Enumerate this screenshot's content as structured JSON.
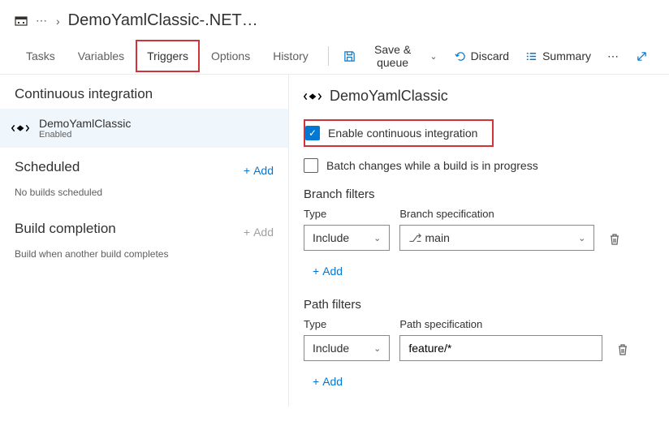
{
  "breadcrumb": {
    "title": "DemoYamlClassic-.NET…"
  },
  "tabs": {
    "tasks": "Tasks",
    "variables": "Variables",
    "triggers": "Triggers",
    "options": "Options",
    "history": "History"
  },
  "toolbar": {
    "save": "Save & queue",
    "discard": "Discard",
    "summary": "Summary"
  },
  "sidebar": {
    "ci_title": "Continuous integration",
    "repo": {
      "name": "DemoYamlClassic",
      "status": "Enabled"
    },
    "scheduled": {
      "title": "Scheduled",
      "add": "Add",
      "empty": "No builds scheduled"
    },
    "completion": {
      "title": "Build completion",
      "add": "Add",
      "empty": "Build when another build completes"
    }
  },
  "main": {
    "title": "DemoYamlClassic",
    "enable_ci": "Enable continuous integration",
    "batch": "Batch changes while a build is in progress",
    "branch_filters": {
      "title": "Branch filters",
      "type_label": "Type",
      "spec_label": "Branch specification",
      "type_value": "Include",
      "spec_value": "main",
      "add": "Add"
    },
    "path_filters": {
      "title": "Path filters",
      "type_label": "Type",
      "spec_label": "Path specification",
      "type_value": "Include",
      "spec_value": "feature/*",
      "add": "Add"
    }
  }
}
